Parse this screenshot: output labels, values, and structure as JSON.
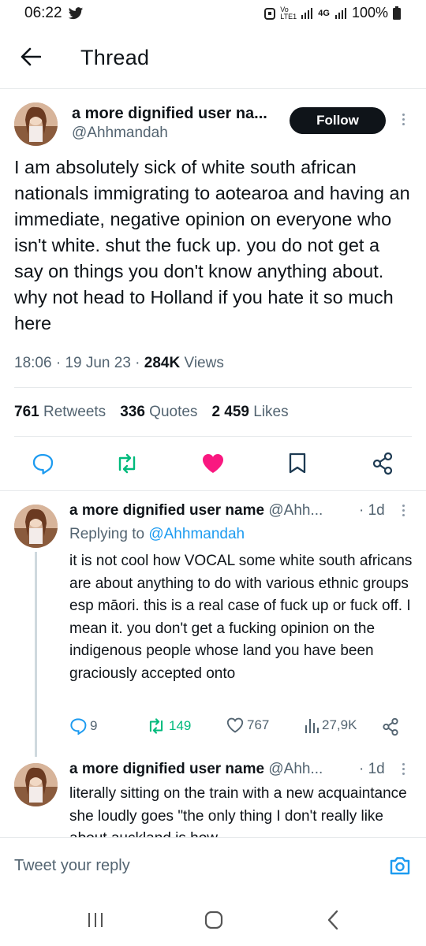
{
  "status": {
    "time": "06:22",
    "net_label": "Vo LTE1",
    "net2": "4G",
    "battery": "100%"
  },
  "header": {
    "title": "Thread"
  },
  "main_tweet": {
    "name": "a more dignified user na...",
    "handle": "@Ahhmandah",
    "follow_label": "Follow",
    "text": "I am absolutely sick of white south african nationals immigrating to aotearoa and having an immediate, negative opinion on everyone who isn't white. shut the fuck up. you do not get a say on things you don't know anything about. why not head to Holland if you hate it so much here",
    "time": "18:06",
    "date": "19 Jun 23",
    "views_count": "284K",
    "views_label": "Views",
    "retweets_count": "761",
    "retweets_label": "Retweets",
    "quotes_count": "336",
    "quotes_label": "Quotes",
    "likes_count": "2 459",
    "likes_label": "Likes",
    "colors": {
      "retweet": "#00ba7c",
      "like": "#f91880"
    }
  },
  "replies": [
    {
      "name": "a more dignified user name",
      "handle": "@Ahh...",
      "age": "1d",
      "replying_prefix": "Replying to",
      "replying_to": "@Ahhmandah",
      "text": "it is not cool how VOCAL some white south africans are about anything to do with various ethnic groups esp māori. this is a real case of fuck up or fuck off. I mean it. you don't get a fucking opinion on the indigenous people whose land you have been graciously accepted onto",
      "replies_count": "9",
      "retweets_count": "149",
      "likes_count": "767",
      "views_count": "27,9K"
    },
    {
      "name": "a more dignified user name",
      "handle": "@Ahh...",
      "age": "1d",
      "text": "literally sitting on the train with a new acquaintance she loudly goes \"the only thing I don't really like about auckland is how"
    }
  ],
  "composer": {
    "placeholder": "Tweet your reply"
  }
}
